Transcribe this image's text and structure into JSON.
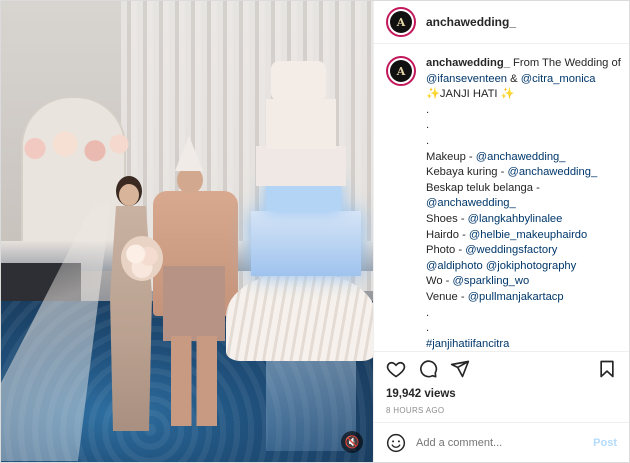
{
  "post": {
    "username": "anchawedding_",
    "avatar_text": "A",
    "mute_icon": "speaker-muted-icon"
  },
  "caption": {
    "username": "anchawedding_",
    "lines": [
      {
        "parts": [
          {
            "t": "user",
            "v": "anchawedding_"
          },
          {
            "t": "text",
            "v": " From The Wedding of"
          }
        ]
      },
      {
        "parts": [
          {
            "t": "mention",
            "v": "@ifanseventeen"
          },
          {
            "t": "text",
            "v": " & "
          },
          {
            "t": "mention",
            "v": "@citra_monica"
          }
        ]
      },
      {
        "parts": [
          {
            "t": "text",
            "v": "✨JANJI HATI ✨"
          }
        ]
      },
      {
        "parts": [
          {
            "t": "text",
            "v": "."
          }
        ]
      },
      {
        "parts": [
          {
            "t": "text",
            "v": "."
          }
        ]
      },
      {
        "parts": [
          {
            "t": "text",
            "v": "."
          }
        ]
      },
      {
        "parts": [
          {
            "t": "text",
            "v": "Makeup - "
          },
          {
            "t": "mention",
            "v": "@anchawedding_"
          }
        ]
      },
      {
        "parts": [
          {
            "t": "text",
            "v": "Kebaya kuring - "
          },
          {
            "t": "mention",
            "v": "@anchawedding_"
          }
        ]
      },
      {
        "parts": [
          {
            "t": "text",
            "v": "Beskap teluk belanga -"
          }
        ]
      },
      {
        "parts": [
          {
            "t": "mention",
            "v": "@anchawedding_"
          }
        ]
      },
      {
        "parts": [
          {
            "t": "text",
            "v": "Shoes - "
          },
          {
            "t": "mention",
            "v": "@langkahbylinalee"
          }
        ]
      },
      {
        "parts": [
          {
            "t": "text",
            "v": "Hairdo - "
          },
          {
            "t": "mention",
            "v": "@helbie_makeuphairdo"
          }
        ]
      },
      {
        "parts": [
          {
            "t": "text",
            "v": "Photo - "
          },
          {
            "t": "mention",
            "v": "@weddingsfactory"
          }
        ]
      },
      {
        "parts": [
          {
            "t": "mention",
            "v": "@aldiphoto"
          },
          {
            "t": "text",
            "v": " "
          },
          {
            "t": "mention",
            "v": "@jokiphotography"
          }
        ]
      },
      {
        "parts": [
          {
            "t": "text",
            "v": "Wo - "
          },
          {
            "t": "mention",
            "v": "@sparkling_wo"
          }
        ]
      },
      {
        "parts": [
          {
            "t": "text",
            "v": "Venue - "
          },
          {
            "t": "mention",
            "v": "@pullmanjakartacp"
          }
        ]
      },
      {
        "parts": [
          {
            "t": "text",
            "v": "."
          }
        ]
      },
      {
        "parts": [
          {
            "t": "text",
            "v": "."
          }
        ]
      },
      {
        "parts": [
          {
            "t": "hash",
            "v": "#janjihatiifancitra"
          }
        ]
      }
    ]
  },
  "actions": {
    "like_icon": "heart-icon",
    "comment_icon": "comment-icon",
    "share_icon": "share-icon",
    "save_icon": "bookmark-icon"
  },
  "stats": {
    "views": "19,942 views",
    "time": "8 HOURS AGO"
  },
  "comment_box": {
    "placeholder": "Add a comment...",
    "post_label": "Post",
    "emoji_icon": "smiley-icon"
  },
  "colors": {
    "mention": "#00376b",
    "story_ring": "#c2185b",
    "post_disabled": "#b3dbff"
  }
}
